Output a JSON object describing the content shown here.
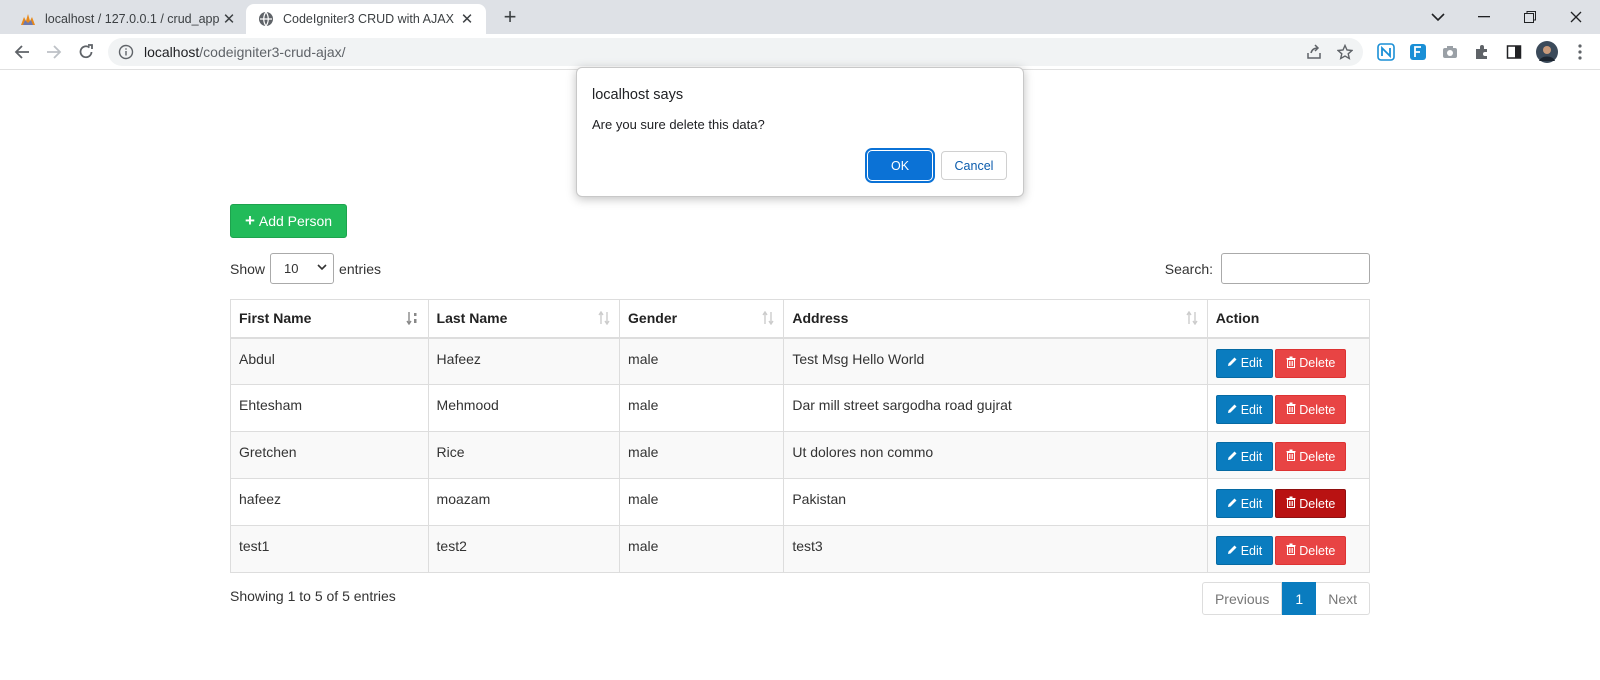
{
  "browser": {
    "tabs": [
      {
        "title": "localhost / 127.0.0.1 / crud_app /",
        "icon": "phpmyadmin-icon"
      },
      {
        "title": "CodeIgniter3 CRUD with AJAX",
        "icon": "globe-icon"
      }
    ],
    "url_host": "localhost",
    "url_path": "/codeigniter3-crud-ajax/"
  },
  "page": {
    "add_button": "Add Person",
    "show_label": "Show",
    "entries_value": "10",
    "entries_label": "entries",
    "search_label": "Search:",
    "columns": [
      "First Name",
      "Last Name",
      "Gender",
      "Address",
      "Action"
    ],
    "rows": [
      {
        "first": "Abdul",
        "last": "Hafeez",
        "gender": "male",
        "address": "Test Msg Hello World"
      },
      {
        "first": "Ehtesham",
        "last": "Mehmood",
        "gender": "male",
        "address": "Dar mill street sargodha road gujrat"
      },
      {
        "first": "Gretchen",
        "last": "Rice",
        "gender": "male",
        "address": "Ut dolores non commo"
      },
      {
        "first": "hafeez",
        "last": "moazam",
        "gender": "male",
        "address": "Pakistan"
      },
      {
        "first": "test1",
        "last": "test2",
        "gender": "male",
        "address": "test3"
      }
    ],
    "edit_label": "Edit",
    "delete_label": "Delete",
    "info": "Showing 1 to 5 of 5 entries",
    "pager": {
      "prev": "Previous",
      "current": "1",
      "next": "Next"
    }
  },
  "dialog": {
    "title": "localhost says",
    "message": "Are you sure delete this data?",
    "ok": "OK",
    "cancel": "Cancel"
  }
}
